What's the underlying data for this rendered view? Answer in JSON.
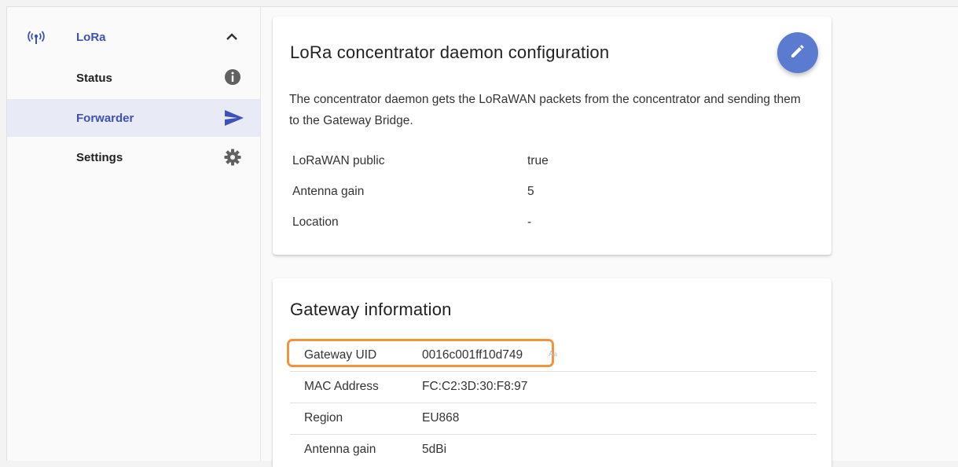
{
  "sidebar": {
    "section": {
      "label": "LoRa",
      "icon": "lora-antenna-icon",
      "toggle_icon": "chevron-up-icon"
    },
    "items": [
      {
        "label": "Status",
        "icon": "info-icon"
      },
      {
        "label": "Forwarder",
        "icon": "send-icon",
        "active": true
      },
      {
        "label": "Settings",
        "icon": "gear-icon"
      }
    ]
  },
  "config_card": {
    "title": "LoRa concentrator daemon configuration",
    "edit_icon": "pencil-icon",
    "description": "The concentrator daemon gets the LoRaWAN packets from the concentrator and sending them to the Gateway Bridge.",
    "fields": [
      {
        "label": "LoRaWAN public",
        "value": "true"
      },
      {
        "label": "Antenna gain",
        "value": "5"
      },
      {
        "label": "Location",
        "value": "-"
      }
    ]
  },
  "gateway_card": {
    "title": "Gateway information",
    "rows": [
      {
        "label": "Gateway UID",
        "value": "0016c001ff10d749"
      },
      {
        "label": "MAC Address",
        "value": "FC:C2:3D:30:F8:97"
      },
      {
        "label": "Region",
        "value": "EU868"
      },
      {
        "label": "Antenna gain",
        "value": "5dBi"
      }
    ]
  },
  "colors": {
    "accent": "#3f51b5",
    "fab": "#5b7bd1",
    "highlight": "#f0953e",
    "active_bg": "#e8eaf6"
  }
}
